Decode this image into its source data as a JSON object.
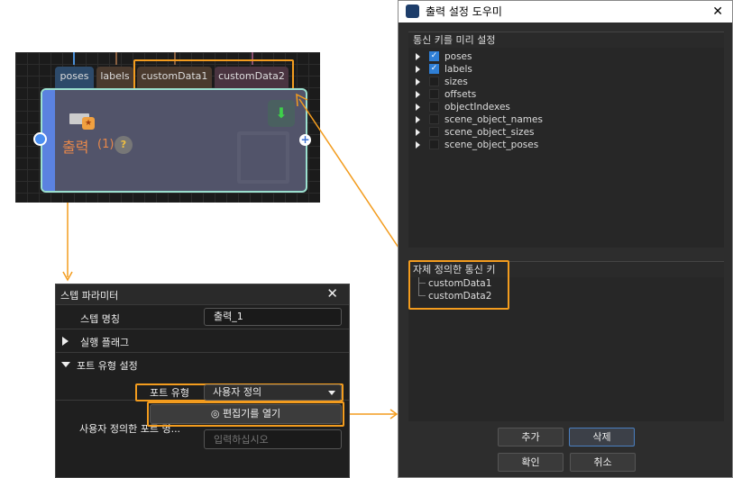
{
  "node": {
    "ports": [
      {
        "label": "poses",
        "color": "#2d4a6a",
        "pin": "#4a90d9"
      },
      {
        "label": "labels",
        "color": "#4a3a2e",
        "pin": "#8a6040"
      },
      {
        "label": "customData1",
        "color": "#4a3a2e",
        "pin": "#8a6040"
      },
      {
        "label": "customData2",
        "color": "#4a3440",
        "pin": "#8a5070"
      }
    ],
    "title": "출력",
    "count": "(1)",
    "help": "?"
  },
  "panel": {
    "title": "스텝 파라미터",
    "step_name_label": "스텝 명칭",
    "step_name_value": "출력_1",
    "exec_flag": "실행 플래그",
    "port_type_section": "포트 유형 설정",
    "port_type_label": "포트 유형",
    "port_type_value": "사용자 정의",
    "custom_port_label": "사용자 정의한 포트 명...",
    "open_editor": "편집기를 열기",
    "input_placeholder": "입력하십시오"
  },
  "dialog": {
    "title": "출력 설정 도우미",
    "preset_header": "통신 키를 미리 설정",
    "preset_keys": [
      {
        "label": "poses",
        "checked": true
      },
      {
        "label": "labels",
        "checked": true
      },
      {
        "label": "sizes",
        "checked": false
      },
      {
        "label": "offsets",
        "checked": false
      },
      {
        "label": "objectIndexes",
        "checked": false
      },
      {
        "label": "scene_object_names",
        "checked": false
      },
      {
        "label": "scene_object_sizes",
        "checked": false
      },
      {
        "label": "scene_object_poses",
        "checked": false
      }
    ],
    "custom_header": "자체 정의한 통신 키",
    "custom_keys": [
      "customData1",
      "customData2"
    ],
    "add": "추가",
    "delete": "삭제",
    "ok": "확인",
    "cancel": "취소"
  },
  "colors": {
    "highlight": "#f39c1e",
    "accent": "#2f7fd6"
  }
}
